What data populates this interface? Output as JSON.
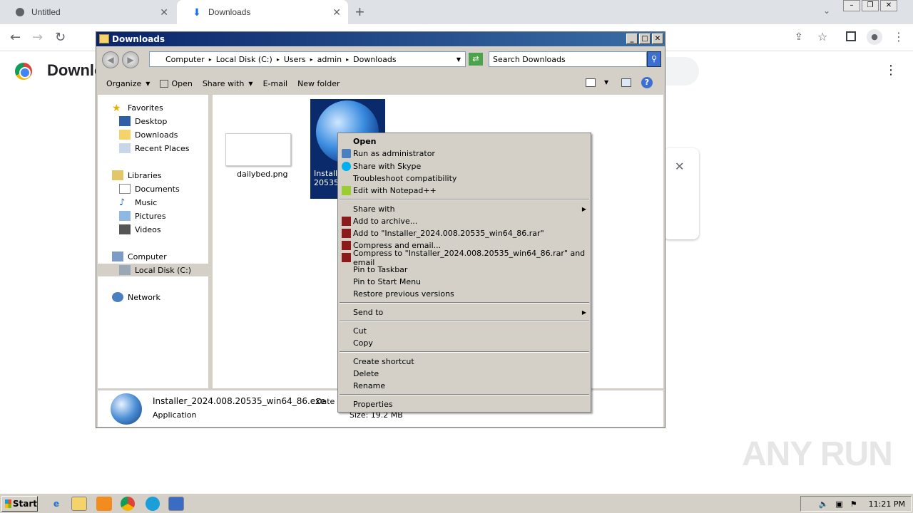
{
  "browser": {
    "tabs": [
      {
        "label": "Untitled",
        "icon": "globe-icon"
      },
      {
        "label": "Downloads",
        "icon": "download-icon"
      }
    ],
    "page_title": "Downlo",
    "new_tab_glyph": "+",
    "menu_glyph": "⋮"
  },
  "explorer": {
    "title": "Downloads",
    "breadcrumb": [
      "Computer",
      "Local Disk (C:)",
      "Users",
      "admin",
      "Downloads"
    ],
    "search_placeholder": "Search Downloads",
    "commands": {
      "organize": "Organize",
      "open": "Open",
      "share_with": "Share with",
      "email": "E-mail",
      "new_folder": "New folder"
    },
    "nav": {
      "favorites": "Favorites",
      "desktop": "Desktop",
      "downloads": "Downloads",
      "recent": "Recent Places",
      "libraries": "Libraries",
      "documents": "Documents",
      "music": "Music",
      "pictures": "Pictures",
      "videos": "Videos",
      "computer": "Computer",
      "local_disk": "Local Disk (C:)",
      "network": "Network"
    },
    "files": [
      {
        "name": "dailybed.png"
      },
      {
        "name_line1": "Installe",
        "name_line2": "20535_"
      }
    ],
    "details": {
      "name": "Installer_2024.008.20535_win64_86.exe",
      "date_label": "Date m",
      "type": "Application",
      "size": "Size: 19.2 MB"
    }
  },
  "context_menu": {
    "open": "Open",
    "run_admin": "Run as administrator",
    "share_skype": "Share with Skype",
    "troubleshoot": "Troubleshoot compatibility",
    "notepad": "Edit with Notepad++",
    "share_with": "Share with",
    "add_archive": "Add to archive...",
    "add_rar": "Add to \"Installer_2024.008.20535_win64_86.rar\"",
    "compress_email": "Compress and email...",
    "compress_rar_email": "Compress to \"Installer_2024.008.20535_win64_86.rar\" and email",
    "pin_taskbar": "Pin to Taskbar",
    "pin_start": "Pin to Start Menu",
    "restore": "Restore previous versions",
    "send_to": "Send to",
    "cut": "Cut",
    "copy": "Copy",
    "create_shortcut": "Create shortcut",
    "delete": "Delete",
    "rename": "Rename",
    "properties": "Properties"
  },
  "taskbar": {
    "start": "Start",
    "clock": "11:21 PM"
  },
  "watermark": "ANY RUN"
}
